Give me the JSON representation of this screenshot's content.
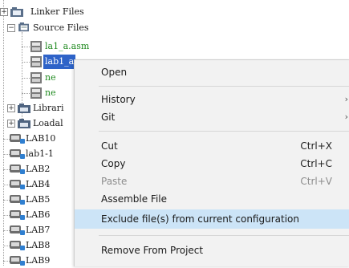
{
  "tree": {
    "linker_files": "Linker Files",
    "source_files": "Source Files",
    "file1": "la1_a.asm",
    "file2_selected": "lab1_a",
    "file3": "ne",
    "file4": "ne",
    "libraries": "Librari",
    "loadables": "Loadal",
    "projects": [
      "LAB10",
      "lab1-1",
      "LAB2",
      "LAB4",
      "LAB5",
      "LAB6",
      "LAB7",
      "LAB8",
      "LAB9"
    ]
  },
  "menu": {
    "open": "Open",
    "history": "History",
    "git": "Git",
    "cut": "Cut",
    "cut_sc": "Ctrl+X",
    "copy": "Copy",
    "copy_sc": "Ctrl+C",
    "paste": "Paste",
    "paste_sc": "Ctrl+V",
    "assemble": "Assemble File",
    "exclude": "Exclude file(s) from current configuration",
    "remove": "Remove From Project",
    "submenu_arrow": "›"
  },
  "colors": {
    "selection": "#2e63c8",
    "menu_highlight": "#cce4f7",
    "green_text": "#1f8a1f"
  }
}
